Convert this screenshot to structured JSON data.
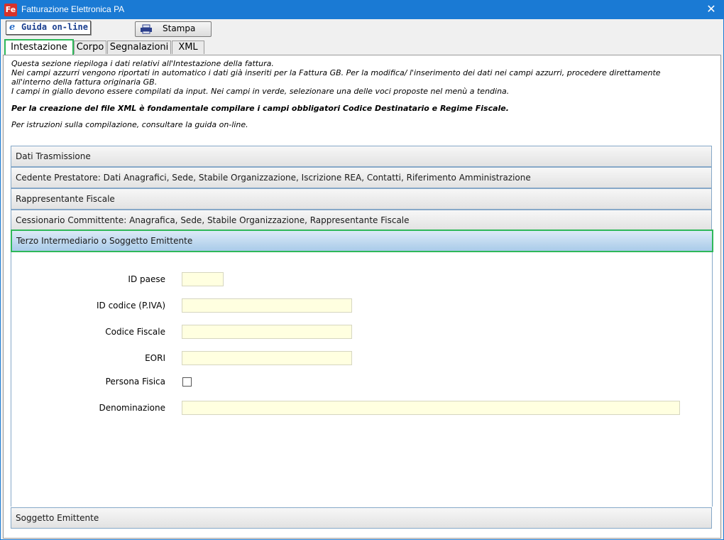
{
  "window": {
    "title": "Fatturazione Elettronica PA",
    "app_icon_text": "Fe"
  },
  "toolbar": {
    "help_label": "Guida on-line",
    "print_label": "Stampa"
  },
  "tabs": [
    {
      "label": "Intestazione",
      "active": true
    },
    {
      "label": "Corpo",
      "active": false
    },
    {
      "label": "Segnalazioni",
      "active": false
    },
    {
      "label": "XML",
      "active": false
    }
  ],
  "info": {
    "line1": "Questa sezione riepiloga i dati relativi all'Intestazione della fattura.",
    "line2": "Nei campi azzurri vengono riportati in automatico i dati già inseriti per la Fattura GB. Per la modifica/ l'inserimento dei dati nei campi azzurri, procedere direttamente",
    "line3": "all'interno della fattura originaria GB.",
    "line4": "I campi in giallo devono essere compilati da input. Nei campi in verde, selezionare una delle voci proposte nel menù a tendina.",
    "bold_line": "Per la creazione del file XML è fondamentale compilare i campi obbligatori Codice Destinatario e Regime Fiscale.",
    "guide_line": "Per istruzioni sulla compilazione, consultare la guida on-line."
  },
  "sections": [
    {
      "label": "Dati Trasmissione"
    },
    {
      "label": "Cedente Prestatore: Dati Anagrafici, Sede, Stabile Organizzazione, Iscrizione REA, Contatti, Riferimento Amministrazione"
    },
    {
      "label": "Rappresentante Fiscale"
    },
    {
      "label": "Cessionario Committente: Anagrafica, Sede, Stabile Organizzazione, Rappresentante Fiscale"
    },
    {
      "label": "Terzo Intermediario o Soggetto Emittente"
    },
    {
      "label": "Soggetto Emittente"
    }
  ],
  "form": {
    "id_paese": {
      "label": "ID paese",
      "value": ""
    },
    "id_codice": {
      "label": "ID codice (P.IVA)",
      "value": ""
    },
    "codice_fiscale": {
      "label": "Codice Fiscale",
      "value": ""
    },
    "eori": {
      "label": "EORI",
      "value": ""
    },
    "persona_fisica": {
      "label": "Persona Fisica",
      "checked": false
    },
    "denominazione": {
      "label": "Denominazione",
      "value": ""
    }
  },
  "colors": {
    "titlebar": "#1a7ad4",
    "input_fill": "#ffffe0",
    "highlight": "#2fb85a",
    "active_section": "#a9cbe9"
  }
}
